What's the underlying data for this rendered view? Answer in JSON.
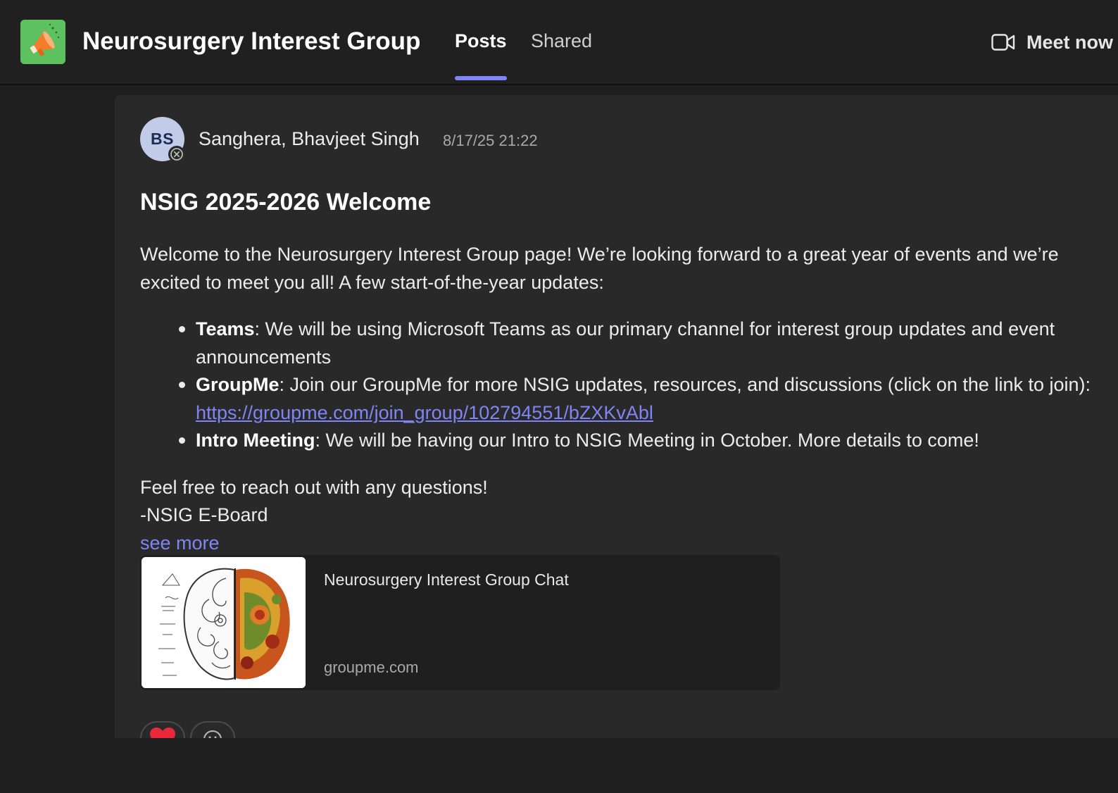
{
  "header": {
    "team_name": "Neurosurgery Interest Group",
    "tabs": [
      {
        "label": "Posts",
        "selected": true
      },
      {
        "label": "Shared",
        "selected": false
      }
    ],
    "meet_now_label": "Meet now"
  },
  "post": {
    "author_initials": "BS",
    "author": "Sanghera, Bhavjeet Singh",
    "timestamp": "8/17/25 21:22",
    "title": "NSIG 2025-2026 Welcome",
    "intro_line1": "Welcome to the Neurosurgery Interest Group page! We’re looking forward to a great year of events and we’re",
    "intro_line2": "excited to meet you all! A few start-of-the-year updates:",
    "bullets": [
      {
        "label": "Teams",
        "text_line1": ": We will be using Microsoft Teams as our primary channel for interest group updates and event",
        "text_line2": "announcements"
      },
      {
        "label": "GroupMe",
        "text_line1": ": Join our GroupMe for more NSIG updates, resources, and discussions (click on the link to join):",
        "link": "https://groupme.com/join_group/102794551/bZXKvAbl"
      },
      {
        "label": "Intro Meeting",
        "text_line1": ": We will be having our Intro to NSIG Meeting in October. More details to come!"
      }
    ],
    "closing_line1": "Feel free to reach out with any questions!",
    "closing_line2": "-NSIG E-Board",
    "see_more_label": "see more",
    "link_preview": {
      "title": "Neurosurgery Interest Group Chat",
      "domain": "groupme.com"
    },
    "reactions": [
      {
        "icon": "heart-icon"
      },
      {
        "icon": "add-reaction-icon"
      }
    ]
  },
  "colors": {
    "accent": "#7f85f5",
    "background": "#1f1f1f",
    "card": "#292929",
    "team_icon": "#5dc15f"
  }
}
